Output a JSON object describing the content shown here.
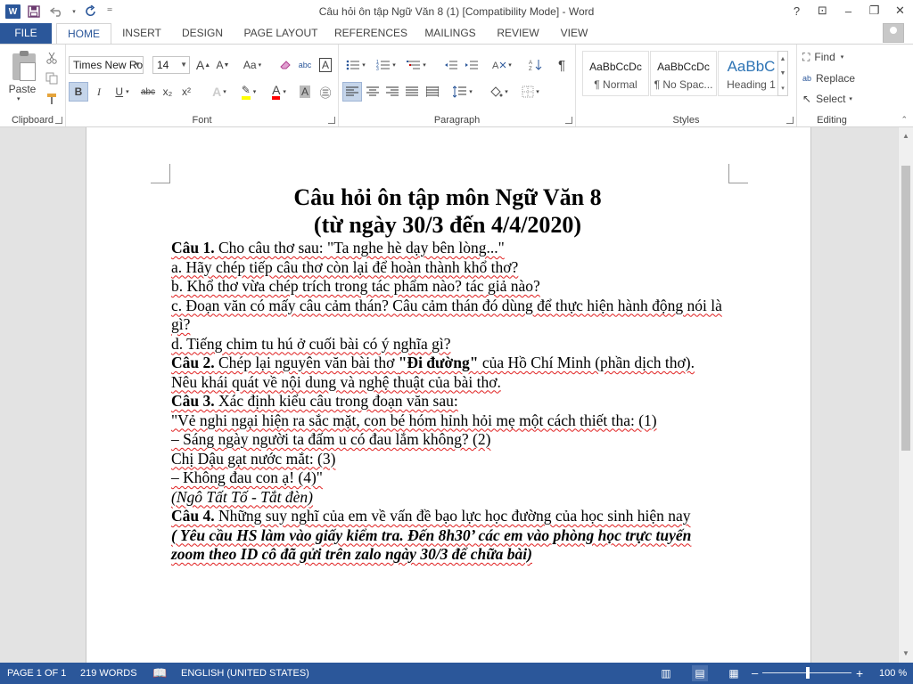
{
  "window": {
    "title": "Câu hỏi ôn tập Ngữ Văn 8 (1) [Compatibility Mode] - Word",
    "help": "?",
    "ribbon_display": "⊡",
    "minimize": "–",
    "restore": "❐",
    "close": "✕"
  },
  "qat": {
    "app_logo": "W",
    "save_icon": "floppy-icon",
    "undo_icon": "undo-icon",
    "redo_icon": "redo-icon",
    "customize": "⁼"
  },
  "tabs": [
    "FILE",
    "HOME",
    "INSERT",
    "DESIGN",
    "PAGE LAYOUT",
    "REFERENCES",
    "MAILINGS",
    "REVIEW",
    "VIEW"
  ],
  "ribbon": {
    "clipboard": {
      "label": "Clipboard",
      "paste": "Paste"
    },
    "font": {
      "label": "Font",
      "font_name": "Times New Ro",
      "font_size": "14",
      "grow": "A",
      "shrink": "A",
      "case": "Aa",
      "bold": "B",
      "italic": "I",
      "underline": "U",
      "strike": "abc",
      "subscript": "x₂",
      "superscript": "x²",
      "effects": "A",
      "color": "A",
      "shading": "A",
      "enclose": "㊂"
    },
    "paragraph": {
      "label": "Paragraph",
      "show_marks": "¶"
    },
    "styles": {
      "label": "Styles",
      "items": [
        {
          "sample": "AaBbCcDc",
          "name": "¶ Normal"
        },
        {
          "sample": "AaBbCcDc",
          "name": "¶ No Spac..."
        },
        {
          "sample": "AaBbC",
          "name": "Heading 1"
        }
      ]
    },
    "editing": {
      "label": "Editing",
      "find": "Find",
      "replace": "Replace",
      "select": "Select"
    }
  },
  "colors": {
    "accent": "#2b579a",
    "squiggle": "#e02020",
    "highlight": "#ffff00",
    "font_color": "#ff0000"
  },
  "document": {
    "title1": "Câu hỏi ôn tập môn Ngữ Văn 8",
    "title2": "(từ ngày 30/3 đến 4/4/2020)",
    "q1_head": "Câu 1.",
    "q1_text": " Cho câu thơ sau: \"Ta nghe hè dạy bên lòng...\"",
    "q1a": "a. Hãy chép tiếp câu thơ còn lại để hoàn thành khổ thơ?",
    "q1b": "b. Khổ thơ vừa chép trích trong tác phẩm nào? tác giả nào?",
    "q1c": "c. Đoạn văn có mấy câu cảm thán? Câu cảm thán đó dùng để thực hiện hành động nói là gì?",
    "q1d": "d. Tiếng chim tu hú ở cuối bài có ý nghĩa gì?",
    "q2_head": "Câu 2.",
    "q2_text1": " Chép lại nguyên văn bài thơ ",
    "q2_bold": "\"Đi đường\"",
    "q2_text2": " của Hồ Chí Minh (phần dịch thơ). Nêu khái quát về nội dung và nghệ thuật của bài thơ.",
    "q3_head": "Câu 3.",
    "q3_text": "  Xác định kiểu câu trong đoạn văn sau:",
    "q3_l1": "\"Vẻ nghi ngại hiện ra sắc mặt, con bé hóm hỉnh hỏi mẹ một cách thiết tha: (1)",
    "q3_l2": "– Sáng ngày người ta đấm u có đau lắm không? (2)",
    "q3_l3": "Chị Dậu gạt nước mắt: (3)",
    "q3_l4": "– Không đau con ạ! (4)\"",
    "q3_src": "(Ngô Tất Tố - Tắt đèn)",
    "q4_head": "Câu 4.",
    "q4_text": "  Những suy nghĩ của em về vấn đề bạo lực học đường của học sinh hiện nay",
    "note": "( Yêu cầu HS làm vào giấy kiểm tra. Đến 8h30’ các em vào phòng học trực tuyến zoom theo ID cô đã gửi trên zalo ngày 30/3 để chữa bài)"
  },
  "status": {
    "page": "PAGE 1 OF 1",
    "words": "219 WORDS",
    "language": "ENGLISH (UNITED STATES)",
    "zoom": "100 %",
    "zoom_minus": "–",
    "zoom_plus": "+"
  },
  "zoom_level_percent": 100
}
